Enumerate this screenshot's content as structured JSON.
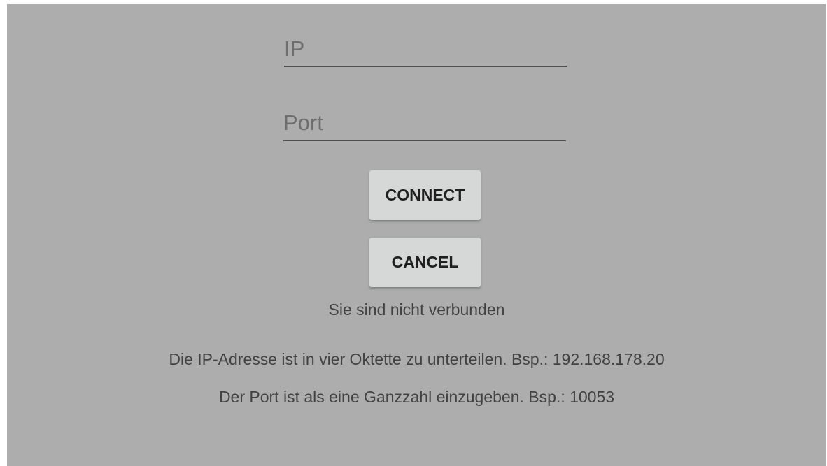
{
  "form": {
    "ip": {
      "value": "",
      "placeholder": "IP"
    },
    "port": {
      "value": "",
      "placeholder": "Port"
    }
  },
  "buttons": {
    "connect_label": "CONNECT",
    "cancel_label": "CANCEL"
  },
  "status_text": "Sie sind nicht verbunden",
  "hints": {
    "ip": "Die IP-Adresse ist in vier Oktette zu unterteilen. Bsp.: 192.168.178.20",
    "port": "Der Port ist als eine Ganzzahl einzugeben. Bsp.: 10053"
  },
  "colors": {
    "background": "#adadad",
    "button": "#d6d7d7",
    "underline": "#4f4f4f",
    "text": "#424242"
  }
}
